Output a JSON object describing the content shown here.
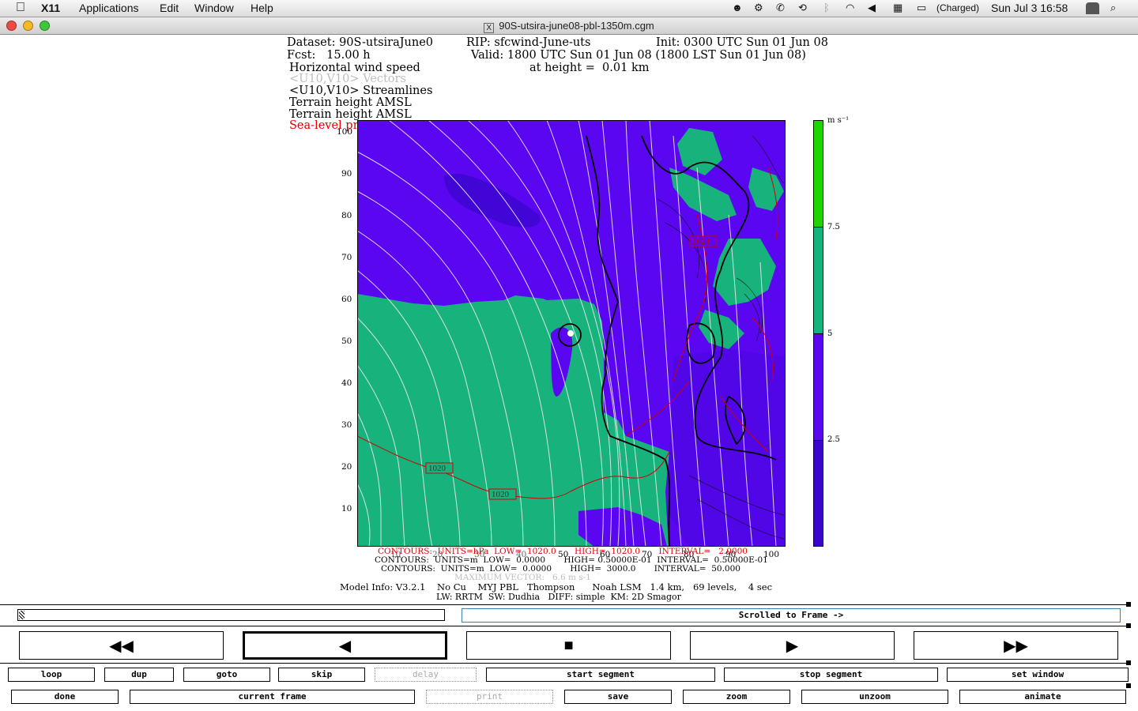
{
  "menubar": {
    "app": "X11",
    "items": [
      "Applications",
      "Edit",
      "Window",
      "Help"
    ],
    "battery": "(Charged)",
    "clock": "Sun Jul 3  16:58"
  },
  "window": {
    "title": "90S-utsira-june08-pbl-1350m.cgm"
  },
  "plot": {
    "dataset": "Dataset: 90S-utsiraJune0",
    "rip": "RIP: sfcwind-June-uts",
    "init": "Init: 0300 UTC Sun 01 Jun 08",
    "fcst": "Fcst:   15.00 h",
    "valid": "Valid: 1800 UTC Sun 01 Jun 08 (1800 LST Sun 01 Jun 08)",
    "field1": "Horizontal wind speed",
    "height": "at height =  0.01 km",
    "field2": "<U10,V10> Vectors",
    "field3": "<U10,V10> Streamlines",
    "field4": "Terrain height AMSL",
    "field5": "Terrain height AMSL",
    "field6": "Sea-level pressure",
    "yticks": [
      "100",
      "90",
      "80",
      "70",
      "60",
      "50",
      "40",
      "30",
      "20",
      "10"
    ],
    "xticks": [
      "10",
      "20",
      "30",
      "40",
      "50",
      "60",
      "70",
      "80",
      "90",
      "100"
    ],
    "colorbar_unit": "m s⁻¹",
    "colorbar_labels": [
      "7.5",
      "5",
      "2.5"
    ],
    "colorbar_colors": [
      "#1fd400",
      "#18b37d",
      "#5a06f0",
      "#3b06c8"
    ],
    "contour_labels": [
      "1020",
      "1020",
      "1024"
    ],
    "contours1": "CONTOURS:  UNITS=hPa  LOW=  1020.0       HIGH=  1020.0       INTERVAL=   2.0000",
    "contours2": "CONTOURS:  UNITS=m  LOW=  0.0000       HIGH= 0.50000E-01  INTERVAL=  0.50000E-01",
    "contours3": "CONTOURS:  UNITS=m  LOW=  0.0000       HIGH=  3000.0       INTERVAL=  50.000",
    "maxvector": "MAXIMUM VECTOR:   6.6 m s-1",
    "modelinfo1": "Model Info: V3.2.1    No Cu    MYJ PBL   Thompson      Noah LSM   1.4 km,   69 levels,    4 sec",
    "modelinfo2": "LW: RRTM  SW: Dudhia   DIFF: simple  KM: 2D Smagor"
  },
  "controls": {
    "status": "Scrolled to Frame ->",
    "nav": [
      "◀◀",
      "◀",
      "■",
      "▶",
      "▶▶"
    ],
    "row1": [
      "loop",
      "dup",
      "goto",
      "skip",
      "delay",
      "start segment",
      "stop segment",
      "set window"
    ],
    "row2": [
      "done",
      "current frame",
      "print",
      "save",
      "zoom",
      "unzoom",
      "animate"
    ]
  }
}
